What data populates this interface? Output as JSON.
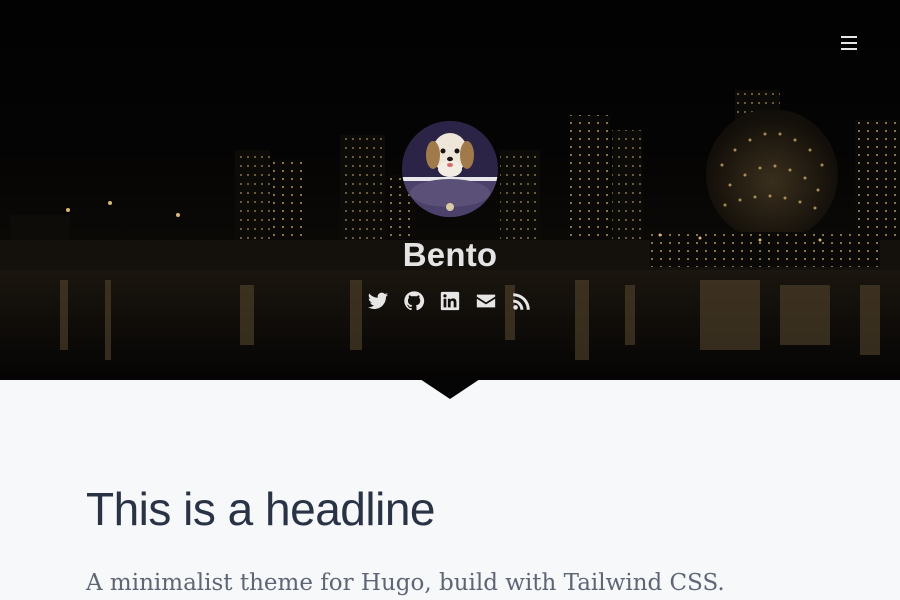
{
  "header": {
    "site_title": "Bento",
    "menu_icon": "hamburger-menu-icon",
    "social_icons": [
      "twitter-icon",
      "github-icon",
      "linkedin-icon",
      "envelope-icon",
      "rss-icon"
    ]
  },
  "content": {
    "headline": "This is a headline",
    "subtitle": "A minimalist theme for Hugo, build with Tailwind CSS."
  },
  "colors": {
    "page_background": "#f7f8fa",
    "hero_background": "#050505",
    "headline": "#2a3345",
    "subtitle": "#5e6676",
    "hero_text": "#e4e4e4"
  }
}
